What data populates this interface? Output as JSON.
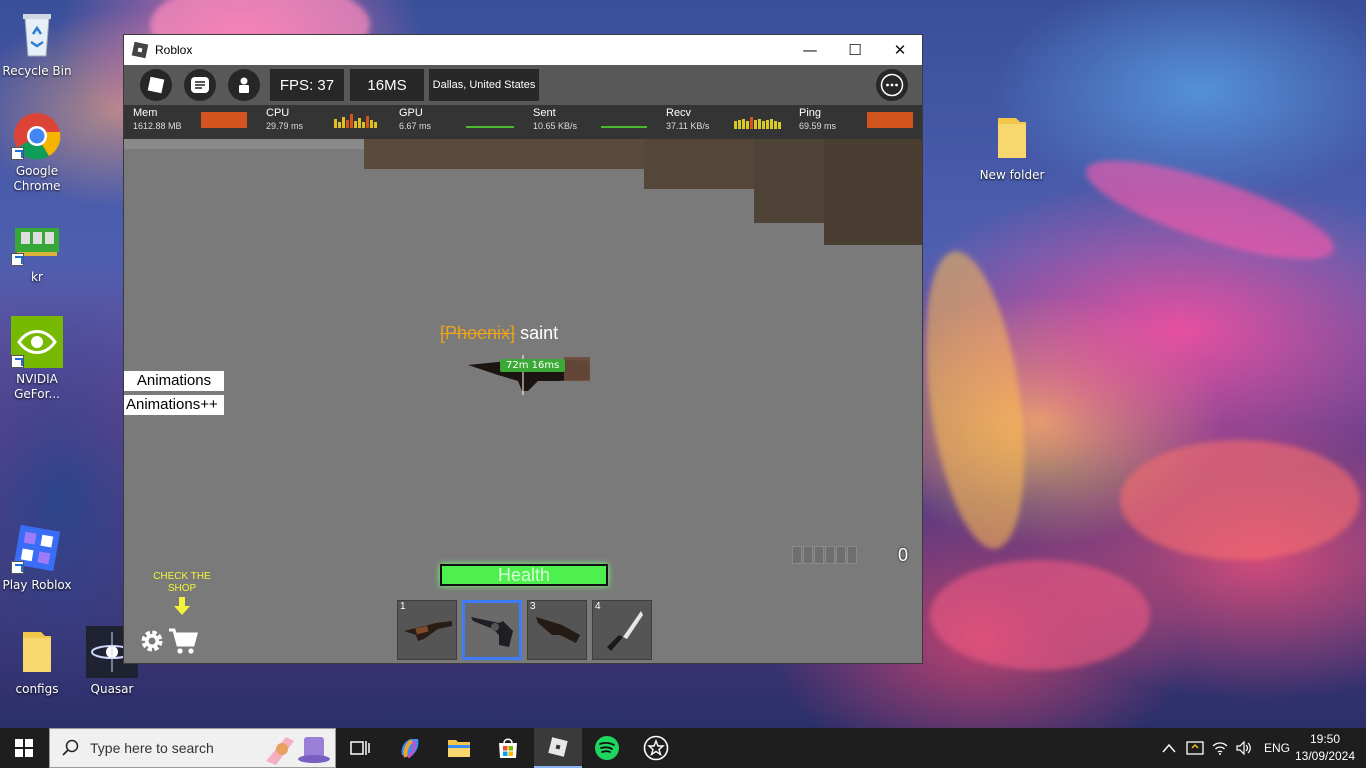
{
  "desktop": {
    "icons": [
      {
        "label": "Recycle Bin"
      },
      {
        "label": "Google Chrome"
      },
      {
        "label": "kr"
      },
      {
        "label": "NVIDIA GeFor..."
      },
      {
        "label": "Play Roblox"
      },
      {
        "label": "configs"
      },
      {
        "label": "Quasar"
      },
      {
        "label": "New folder"
      }
    ]
  },
  "window": {
    "title": "Roblox",
    "controls": {
      "minimize": "—",
      "maximize": "☐",
      "close": "✕"
    }
  },
  "topbar": {
    "fps": "FPS: 37",
    "ping": "16MS",
    "server": "Dallas, United States"
  },
  "stats": {
    "mem": {
      "label": "Mem",
      "value": "1612.88 MB"
    },
    "cpu": {
      "label": "CPU",
      "value": "29.79 ms"
    },
    "gpu": {
      "label": "GPU",
      "value": "6.67 ms"
    },
    "sent": {
      "label": "Sent",
      "value": "10.65 KB/s"
    },
    "recv": {
      "label": "Recv",
      "value": "37.11 KB/s"
    },
    "ping": {
      "label": "Ping",
      "value": "69.59 ms"
    }
  },
  "game": {
    "animations_button": "Animations",
    "animations_plus_button": "Animations++",
    "nametag_clan": "[Phoenix]",
    "nametag_name": " saint",
    "player_ping": "72m  16ms",
    "health_label": "Health",
    "shop_hint": "CHECK THE SHOP",
    "ammo_count": "0",
    "hotbar": [
      {
        "num": "1",
        "item": "shotgun"
      },
      {
        "num": "",
        "item": "revolver"
      },
      {
        "num": "3",
        "item": "sawed-off"
      },
      {
        "num": "4",
        "item": "knife"
      }
    ]
  },
  "taskbar": {
    "search_placeholder": "Type here to search",
    "language": "ENG",
    "time": "19:50",
    "date": "13/09/2024"
  }
}
